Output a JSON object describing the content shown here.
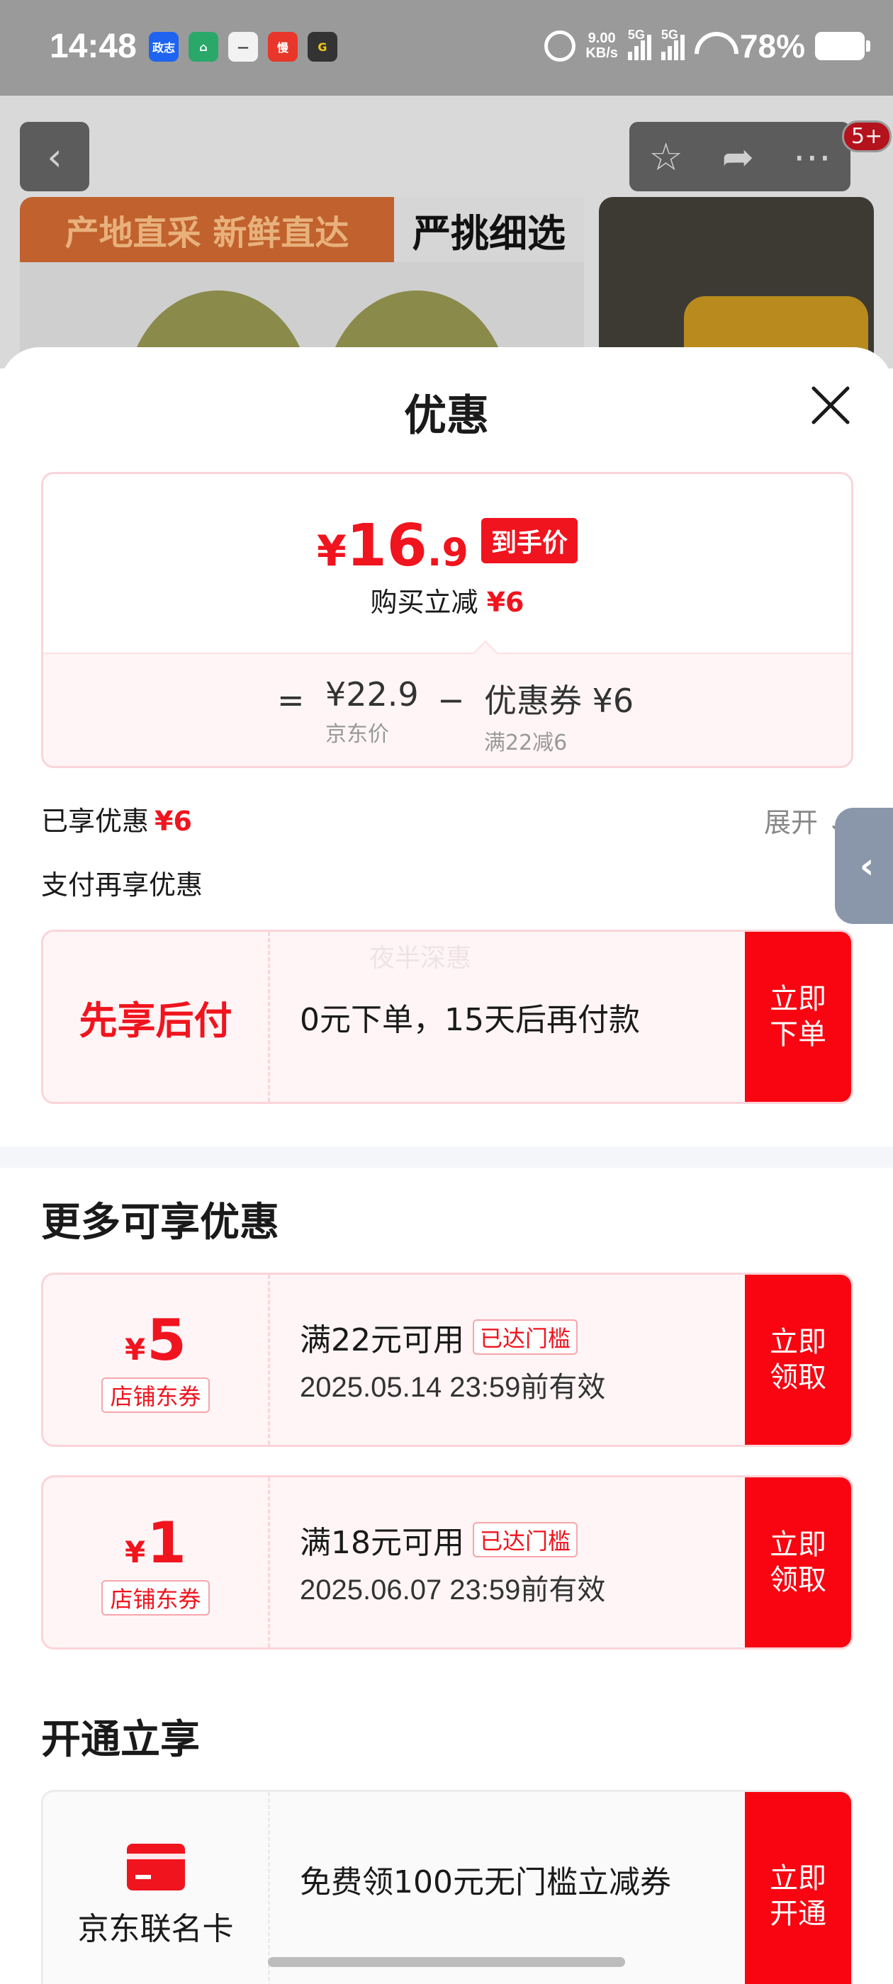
{
  "status_bar": {
    "time": "14:48",
    "apps": [
      {
        "label": "政志",
        "color": "#1e64f0"
      },
      {
        "label": "⌂",
        "color": "#2aa86a"
      },
      {
        "label": "—",
        "color": "#f2f2f2"
      },
      {
        "label": "慢",
        "color": "#e8362a"
      },
      {
        "label": "G",
        "color": "#333333"
      }
    ],
    "net_speed_value": "9.00",
    "net_speed_unit": "KB/s",
    "signal1": "5G",
    "signal2": "5G",
    "battery": "78%"
  },
  "background": {
    "badge": "5+",
    "banner_text": "产地直采 新鲜直达",
    "banner_right": "严挑细选"
  },
  "sheet": {
    "title": "优惠",
    "price": {
      "yen": "¥",
      "integer": "16",
      "decimal": ".9",
      "tag": "到手价",
      "subtitle": "购买立减",
      "subtitle_amount": "¥6"
    },
    "formula": {
      "equals": "=",
      "jd_price": "¥22.9",
      "jd_price_label": "京东价",
      "minus": "−",
      "coupon": "优惠券 ¥6",
      "coupon_label": "满22减6"
    },
    "enjoyed_label": "已享优惠",
    "enjoyed_amount": "¥6",
    "expand_label": "展开",
    "pay_more_label": "支付再享优惠",
    "pay_later": {
      "title": "先享后付",
      "description": "0元下单，15天后再付款",
      "watermark": "夜半深惠",
      "button": "立即下单"
    },
    "more_offers_title": "更多可享优惠",
    "coupons": [
      {
        "yen": "¥",
        "amount": "5",
        "type": "店铺东券",
        "condition": "满22元可用",
        "badge": "已达门槛",
        "expiry": "2025.05.14 23:59前有效",
        "button": "立即领取"
      },
      {
        "yen": "¥",
        "amount": "1",
        "type": "店铺东券",
        "condition": "满18元可用",
        "badge": "已达门槛",
        "expiry": "2025.06.07 23:59前有效",
        "button": "立即领取"
      }
    ],
    "open_title": "开通立享",
    "card_offer": {
      "name": "京东联名卡",
      "description": "免费领100元无门槛立减券",
      "button": "立即开通"
    }
  },
  "colors": {
    "accent_red": "#f0141e",
    "button_red": "#f80511",
    "card_border": "#fbd4da"
  }
}
